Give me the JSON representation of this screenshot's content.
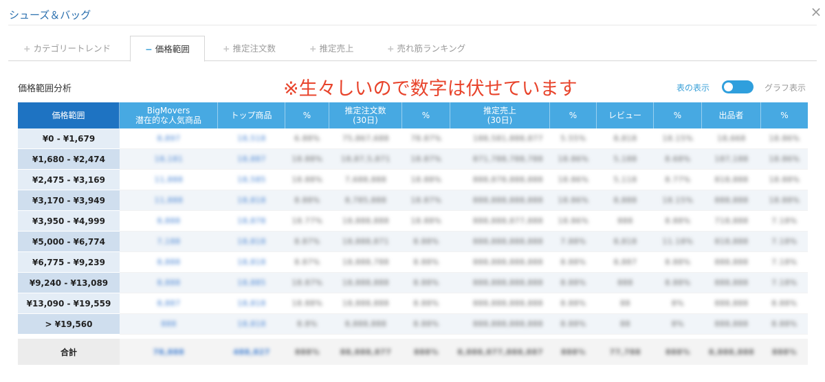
{
  "window": {
    "title": "シューズ＆バッグ",
    "close_icon": "close-icon"
  },
  "tabs": [
    {
      "label": "カテゴリートレンド",
      "symbol": "+",
      "active": false
    },
    {
      "label": "価格範囲",
      "symbol": "−",
      "active": true
    },
    {
      "label": "推定注文数",
      "symbol": "+",
      "active": false
    },
    {
      "label": "推定売上",
      "symbol": "+",
      "active": false
    },
    {
      "label": "売れ筋ランキング",
      "symbol": "+",
      "active": false
    }
  ],
  "section": {
    "title": "価格範囲分析",
    "notice": "※生々しいので数字は伏せています"
  },
  "view_toggle": {
    "table_label": "表の表示",
    "graph_label": "グラフ表示",
    "state": "table"
  },
  "colors": {
    "accent": "#47a9e2",
    "header_dark": "#1e73c2",
    "notice": "#e8442c",
    "title": "#2a6fae"
  },
  "table": {
    "headers": [
      {
        "line1": "価格範囲",
        "line2": ""
      },
      {
        "line1": "BigMovers",
        "line2": "潜在的な人気商品"
      },
      {
        "line1": "トップ商品",
        "line2": ""
      },
      {
        "line1": "%",
        "line2": ""
      },
      {
        "line1": "推定注文数",
        "line2": "(30日)"
      },
      {
        "line1": "%",
        "line2": ""
      },
      {
        "line1": "推定売上",
        "line2": "(30日)"
      },
      {
        "line1": "%",
        "line2": ""
      },
      {
        "line1": "レビュー",
        "line2": ""
      },
      {
        "line1": "%",
        "line2": ""
      },
      {
        "line1": "出品者",
        "line2": ""
      },
      {
        "line1": "%",
        "line2": ""
      }
    ],
    "rows": [
      {
        "range": "¥0 - ¥1,679",
        "cells": [
          "8,897",
          "18,518",
          "6.88%",
          "75,867,688",
          "78.87%",
          "188,581,888,877",
          "5.55%",
          "8,818",
          "18.15%",
          "18,668",
          "18.86%"
        ]
      },
      {
        "range": "¥1,680 - ¥2,474",
        "cells": [
          "18,181",
          "18,887",
          "18.88%",
          "18,87,5,871",
          "18.87%",
          "871,788,788,788",
          "18.86%",
          "5,188",
          "8.68%",
          "187,188",
          "18.86%"
        ]
      },
      {
        "range": "¥2,475 - ¥3,169",
        "cells": [
          "11,888",
          "18,585",
          "18.88%",
          "7,688,888",
          "18.88%",
          "888,878,888,888",
          "18.86%",
          "5,118",
          "8.77%",
          "818,888",
          "18.88%"
        ]
      },
      {
        "range": "¥3,170 - ¥3,949",
        "cells": [
          "11,888",
          "18,818",
          "8.88%",
          "8,785,888",
          "18.87%",
          "888,888,888,888",
          "18.86%",
          "8,888",
          "18.15%",
          "888,888",
          "18.88%"
        ]
      },
      {
        "range": "¥3,950 - ¥4,999",
        "cells": [
          "8,888",
          "18,878",
          "18.77%",
          "18,888,888",
          "18.88%",
          "888,888,877,888",
          "18.86%",
          "888",
          "8.88%",
          "718,888",
          "7.18%"
        ]
      },
      {
        "range": "¥5,000 - ¥6,774",
        "cells": [
          "7,188",
          "18,818",
          "8.87%",
          "18,888,871",
          "8.88%",
          "888,888,888,888",
          "7.88%",
          "8,818",
          "11.18%",
          "818,888",
          "7.18%"
        ]
      },
      {
        "range": "¥6,775 - ¥9,239",
        "cells": [
          "8,888",
          "18,818",
          "8.87%",
          "18,888,788",
          "8.88%",
          "888,888,888,888",
          "8.88%",
          "8,887",
          "8.88%",
          "888,888",
          "7.18%"
        ]
      },
      {
        "range": "¥9,240 - ¥13,089",
        "cells": [
          "8,888",
          "18,885",
          "18.87%",
          "18,888,888",
          "8.88%",
          "888,888,888,888",
          "8.88%",
          "888",
          "8.88%",
          "888,888",
          "7.18%"
        ]
      },
      {
        "range": "¥13,090 - ¥19,559",
        "cells": [
          "8,887",
          "18,818",
          "18.88%",
          "18,888,888",
          "8.88%",
          "888,888,888,888",
          "8.88%",
          "88",
          "8%",
          "888,888",
          "8.88%"
        ]
      },
      {
        "range": "> ¥19,560",
        "cells": [
          "888",
          "18,818",
          "8.8%",
          "8,888,888",
          "8.88%",
          "888,888,888,888",
          "8.88%",
          "88",
          "8%",
          "888,888",
          "8.88%"
        ]
      }
    ],
    "total": {
      "range": "合計",
      "cells": [
        "78,888",
        "488,827",
        "888%",
        "88,888,877",
        "888%",
        "8,888,877,888,887",
        "888%",
        "77,788",
        "888%",
        "8,888,888",
        "888%"
      ]
    }
  }
}
